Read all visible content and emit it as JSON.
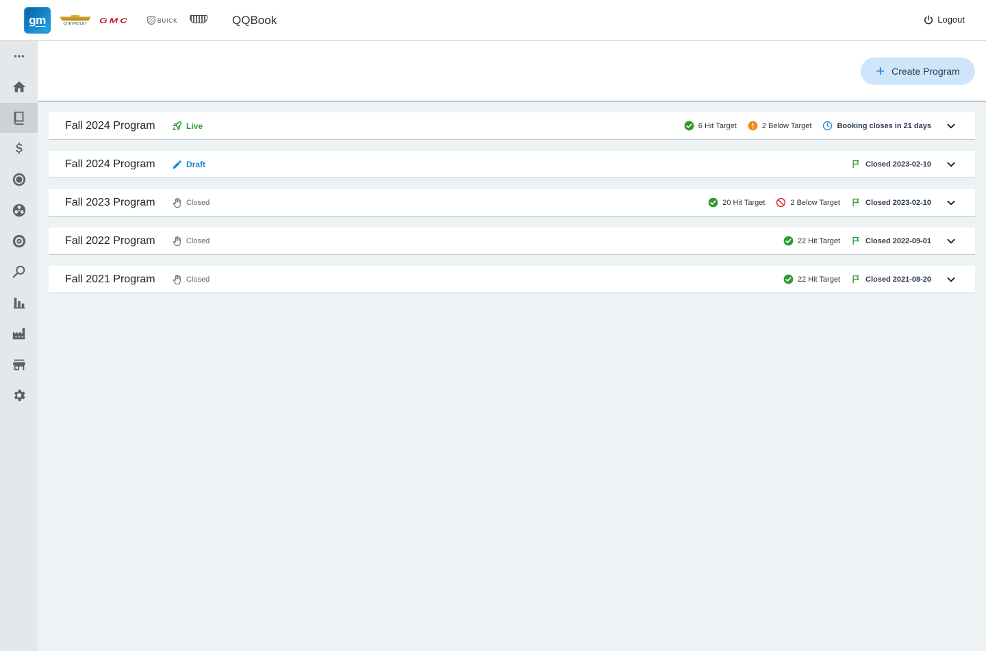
{
  "header": {
    "logo_text": "gm",
    "brands": {
      "chevrolet": "CHEVROLET",
      "gmc": "GMC",
      "buick": "BUICK"
    },
    "app_title": "QQBook",
    "logout_label": "Logout"
  },
  "sidebar": {
    "items": [
      {
        "name": "more",
        "icon": "more-horizontal-icon"
      },
      {
        "name": "home",
        "icon": "home-icon"
      },
      {
        "name": "programs",
        "icon": "book-icon",
        "active": true
      },
      {
        "name": "pricing",
        "icon": "dollar-icon"
      },
      {
        "name": "target",
        "icon": "target-icon"
      },
      {
        "name": "wheel",
        "icon": "wheel-icon"
      },
      {
        "name": "tire",
        "icon": "tire-icon"
      },
      {
        "name": "search",
        "icon": "search-icon"
      },
      {
        "name": "reports",
        "icon": "bar-chart-icon"
      },
      {
        "name": "factory",
        "icon": "factory-icon"
      },
      {
        "name": "store",
        "icon": "store-icon"
      },
      {
        "name": "settings",
        "icon": "gear-icon"
      }
    ]
  },
  "toolbar": {
    "create_label": "Create Program"
  },
  "programs": [
    {
      "title": "Fall 2024 Program",
      "status": "Live",
      "hit": "6 Hit Target",
      "below": "2 Below Target",
      "info": "Booking closes in 21 days"
    },
    {
      "title": "Fall 2024 Program",
      "status": "Draft",
      "info": "Closed 2023-02-10"
    },
    {
      "title": "Fall 2023 Program",
      "status": "Closed",
      "hit": "20 Hit Target",
      "below": "2 Below Target",
      "info": "Closed 2023-02-10"
    },
    {
      "title": "Fall 2022 Program",
      "status": "Closed",
      "hit": "22 Hit Target",
      "info": "Closed 2022-09-01"
    },
    {
      "title": "Fall 2021 Program",
      "status": "Closed",
      "hit": "22 Hit Target",
      "info": "Closed 2021-08-20"
    }
  ],
  "colors": {
    "live": "#2f9b2f",
    "draft": "#1e88d8",
    "warning": "#f08a1c",
    "error": "#d62f2f",
    "accent": "#cfe6fa"
  }
}
